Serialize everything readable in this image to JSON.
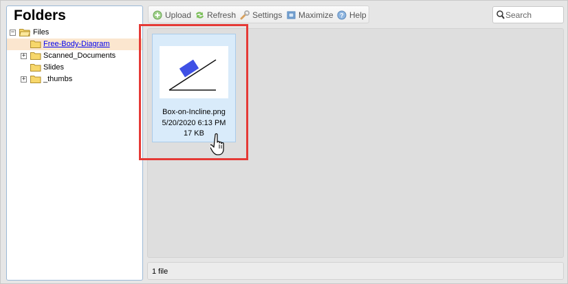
{
  "sidebar": {
    "title": "Folders",
    "tree": [
      {
        "label": "Files",
        "expander": "−",
        "open": true
      },
      {
        "label": "Free-Body-Diagram",
        "selected": true
      },
      {
        "label": "Scanned_Documents",
        "expander": "+"
      },
      {
        "label": "Slides"
      },
      {
        "label": "_thumbs",
        "expander": "+"
      }
    ]
  },
  "toolbar": {
    "upload": {
      "label": "Upload",
      "icon": "plus-circle-icon"
    },
    "refresh": {
      "label": "Refresh",
      "icon": "refresh-arrows-icon"
    },
    "settings": {
      "label": "Settings",
      "icon": "wrench-icon"
    },
    "maximize": {
      "label": "Maximize",
      "icon": "maximize-icon"
    },
    "help": {
      "label": "Help",
      "icon": "question-icon"
    }
  },
  "search": {
    "placeholder": "Search",
    "value": ""
  },
  "files": [
    {
      "name": "Box-on-Incline.png",
      "date": "5/20/2020 6:13 PM",
      "size": "17 KB"
    }
  ],
  "status": {
    "text": "1 file"
  },
  "colors": {
    "selection_bg": "#fbe6cf",
    "tile_bg": "#d9ebfa",
    "highlight": "#e53935",
    "thumbnail_box": "#3f51e5",
    "link": "#0000ee"
  }
}
